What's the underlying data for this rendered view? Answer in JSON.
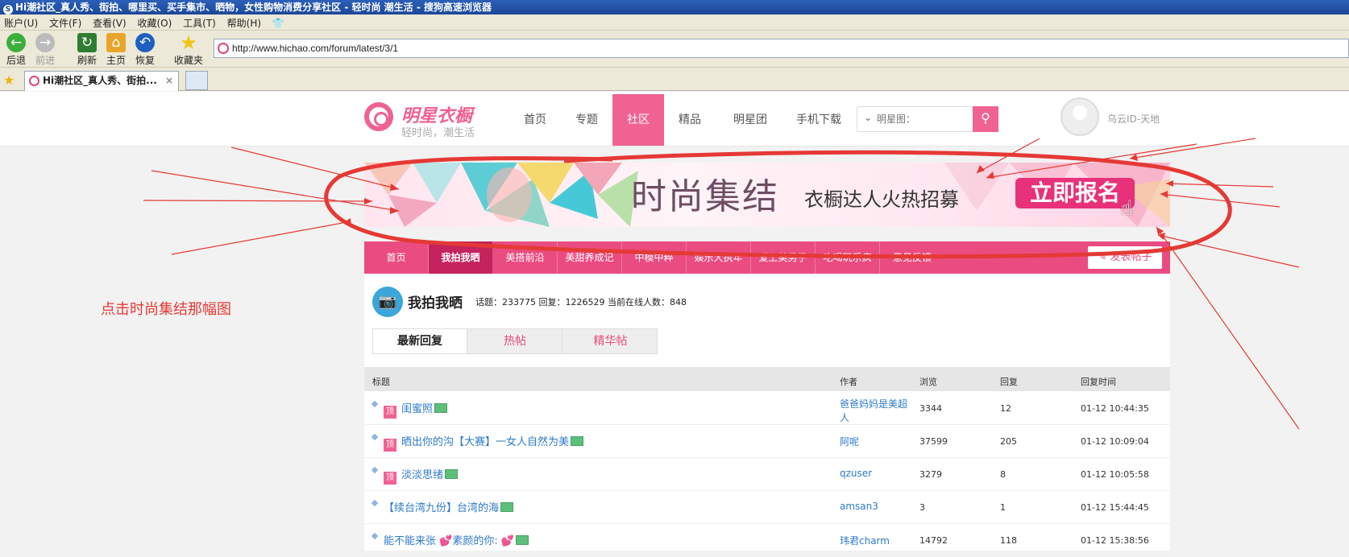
{
  "browser": {
    "title": "Hi潮社区_真人秀、街拍、哪里买、买手集市、晒物，女性购物消费分享社区 - 轻时尚 潮生活 - 搜狗高速浏览器",
    "menu": [
      "账户(U)",
      "文件(F)",
      "查看(V)",
      "收藏(O)",
      "工具(T)",
      "帮助(H)"
    ],
    "toolbar": {
      "back": "后退",
      "forward": "前进",
      "refresh": "刷新",
      "home": "主页",
      "restore": "恢复",
      "favorites": "收藏夹"
    },
    "url": "http://www.hichao.com/forum/latest/3/1",
    "tab_title": "Hi潮社区_真人秀、街拍..."
  },
  "site": {
    "logo_title": "明星衣橱",
    "logo_sub": "轻时尚，潮生活",
    "nav": [
      "首页",
      "专题",
      "社区",
      "精品",
      "明星团",
      "手机下载"
    ],
    "search_placeholder": "明星图：",
    "username": "乌云ID-天地"
  },
  "banner": {
    "title": "时尚集结",
    "subtitle": "衣橱达人火热招募",
    "cta": "立即报名"
  },
  "subnav": {
    "items": [
      "首页",
      "我拍我晒",
      "美搭前沿",
      "美甜养成记",
      "中模中粹",
      "娱乐大执年",
      "爱上美男子",
      "吃喝玩乐疯",
      "意见反馈"
    ],
    "post_button": "发表帖子"
  },
  "forum": {
    "title": "我拍我晒",
    "stats": "话题：233775   回复：1226529   当前在线人数：848",
    "tabs": [
      "最新回复",
      "热帖",
      "精华帖"
    ],
    "columns": [
      "标题",
      "作者",
      "浏览",
      "回复",
      "回复时间"
    ],
    "rows": [
      {
        "pinned": "顶",
        "title": "闺蜜照",
        "author": "爸爸妈妈是美超人",
        "views": "3344",
        "replies": "12",
        "time": "01-12 10:44:35"
      },
      {
        "pinned": "顶",
        "title": "晒出你的沟【大赛】一女人自然为美",
        "author": "阿呢",
        "views": "37599",
        "replies": "205",
        "time": "01-12 10:09:04"
      },
      {
        "pinned": "顶",
        "title": "淡淡思绪",
        "author": "qzuser",
        "views": "3279",
        "replies": "8",
        "time": "01-12 10:05:58"
      },
      {
        "pinned": "",
        "title": "【续台湾九份】台湾的海",
        "author": "amsan3",
        "views": "3",
        "replies": "1",
        "time": "01-12 15:44:45"
      },
      {
        "pinned": "",
        "title": "能不能来张 💕素颜的你: 💕",
        "author": "玮君charm",
        "views": "14792",
        "replies": "118",
        "time": "01-12 15:38:56"
      }
    ]
  },
  "annotation": {
    "note": "点击时尚集结那幅图",
    "color": "#e53935"
  }
}
